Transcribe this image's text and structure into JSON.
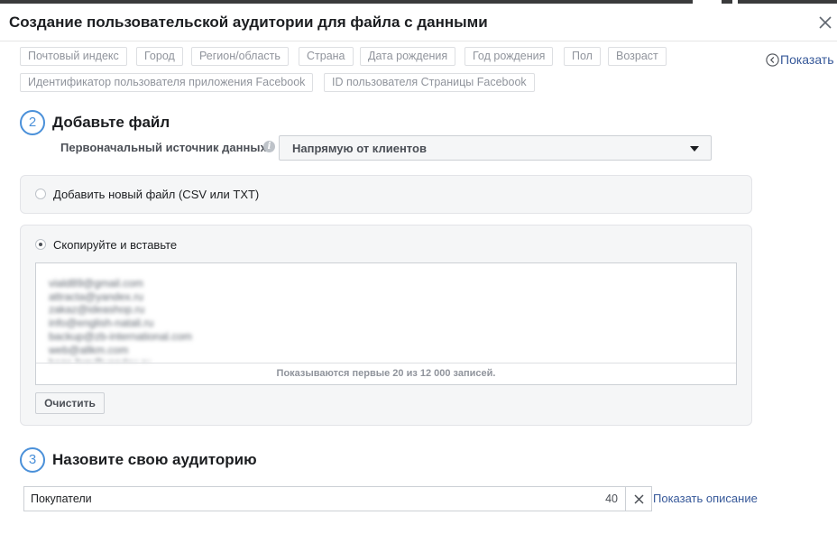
{
  "dialog": {
    "title": "Создание пользовательской аудитории для файла с данными"
  },
  "identifier_tags": [
    "Почтовый индекс",
    "Город",
    "Регион/область",
    "Страна",
    "Дата рождения",
    "Год рождения",
    "Пол",
    "Возраст",
    "Идентификатор пользователя приложения Facebook",
    "ID пользователя Страницы Facebook"
  ],
  "show_link": "Показать",
  "step2": {
    "number": "2",
    "title": "Добавьте файл",
    "source_label": "Первоначальный источник данных",
    "source_value": "Напрямую от клиентов",
    "option_file": "Добавить новый файл (CSV или TXT)",
    "option_paste": "Скопируйте и вставьте",
    "selected_option": "paste",
    "pasted_emails": [
      "viald89@gmail.com",
      "attracta@yandex.ru",
      "zakaz@ideashop.ru",
      "info@english-natali.ru",
      "backup@zb-international.com",
      "web@allkm.com",
      "baza.fsm@yandex.ru"
    ],
    "records_note": "Показываются первые 20 из 12 000 записей.",
    "clear_button": "Очистить"
  },
  "step3": {
    "number": "3",
    "title": "Назовите свою аудиторию",
    "audience_name": "Покупатели",
    "char_count": "40",
    "show_description": "Показать описание"
  },
  "colors": {
    "accent": "#4a90d9",
    "link": "#365899",
    "panel_bg": "#f5f6f7"
  }
}
